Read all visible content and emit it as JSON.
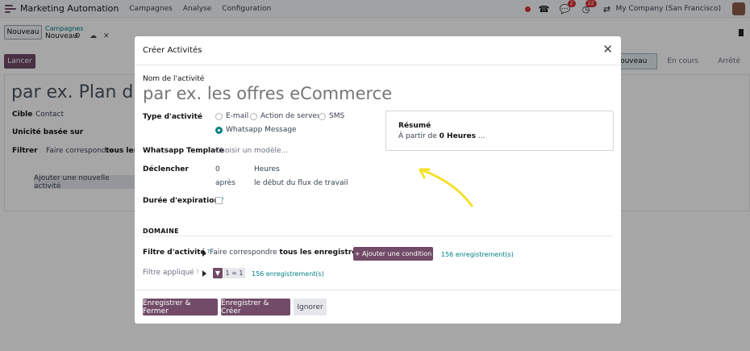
{
  "navbar": {
    "app_name": "Marketing Automation",
    "menus": [
      "Campagnes",
      "Analyse",
      "Configuration"
    ],
    "activity_badge": "2",
    "chat_badge": "22",
    "company": "My Company (San Francisco)"
  },
  "control_panel": {
    "new_label": "Nouveau",
    "breadcrumb_parent": "Campagnes",
    "breadcrumb_current": "Nouveau"
  },
  "form": {
    "launch_label": "Lancer",
    "stages": [
      "Nouveau",
      "En cours",
      "Arrêté"
    ],
    "title_placeholder": "par ex. Plan d'off",
    "target_label": "Cible",
    "target_value": "Contact",
    "uniqueness_label": "Unicité basée sur",
    "filter_label": "Filtrer",
    "filter_text": "Faire correspondre",
    "filter_bold": "tous les e",
    "add_activity_label": "Ajouter une nouvelle activité"
  },
  "modal": {
    "title": "Créer Activités",
    "name_label": "Nom de l'activité",
    "name_placeholder": "par ex. les offres eCommerce",
    "type_label": "Type d'activité",
    "type_options": [
      "E-mail",
      "Action de serveur",
      "SMS",
      "Whatsapp Message"
    ],
    "type_selected": "Whatsapp Message",
    "template_label": "Whatsapp Template",
    "template_placeholder": "Choisir un modèle...",
    "trigger_label": "Déclencher",
    "trigger_value": "0",
    "trigger_unit": "Heures",
    "trigger_when": "après",
    "trigger_event": "le début du flux de travail",
    "expiry_label": "Durée d'expiration",
    "summary_title": "Résumé",
    "summary_prefix": "À partir de ",
    "summary_bold": "0 Heures",
    "summary_suffix": " ...",
    "domain_title": "DOMAINE",
    "activity_filter_label": "Filtre d'activité",
    "filter_text": "Faire correspondre ",
    "filter_bold": "tous les enregistrements",
    "add_condition_label": "+ Ajouter une condition",
    "records_count": "156 enregistrement(s)",
    "applied_filter_label": "Filtre appliqué",
    "applied_tag": "1 = 1",
    "save_close_label": "Enregistrer & Fermer",
    "save_new_label": "Enregistrer & Créer",
    "ignore_label": "Ignorer"
  },
  "colors": {
    "primary": "#714b67",
    "teal": "#017e84",
    "arrow": "#f5e02a",
    "badge": "#d9323a"
  }
}
